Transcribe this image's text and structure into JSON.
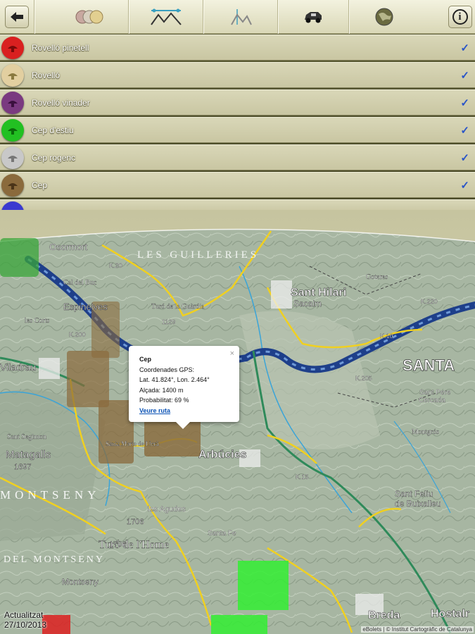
{
  "species": [
    {
      "label": "Rovelló pinetell",
      "color": "#d92020",
      "checked": "✓"
    },
    {
      "label": "Rovelló",
      "color": "#e2cfa0",
      "checked": "✓"
    },
    {
      "label": "Rovelló vinader",
      "color": "#7a3a80",
      "checked": "✓"
    },
    {
      "label": "Cep d'estiu",
      "color": "#22c022",
      "checked": "✓"
    },
    {
      "label": "Cep rogenc",
      "color": "#c8c8c8",
      "checked": "✓"
    },
    {
      "label": "Cep",
      "color": "#8a6a3c",
      "checked": "✓"
    }
  ],
  "toolbar": {
    "info_label": "i"
  },
  "map": {
    "places": {
      "osormort": "Osormort",
      "les_guilleries": "LES GUILLERIES",
      "sant_hilari": "Sant Hilari",
      "sacalm": "Sacalm",
      "santa": "SANTA",
      "espinelves": "Espinelves",
      "viladrau": "Viladrau",
      "matagalls": "Matagalls",
      "matagalls_alt": "1697",
      "arbucies": "Arbúcies",
      "sant_feliu": "Sant Feliu",
      "de_buixalleu": "de Buixalleu",
      "turo_home": "Turó de l'Home",
      "turo_alt": "1706",
      "turo_alt2": "1706",
      "del_montseny": "DEL MONTSENY",
      "montseny": "Montseny",
      "montseny_range": "MONTSENY",
      "breda": "Breda",
      "hostalric": "Hostalr",
      "les_agudes": "les Agudes",
      "santa_fe": "Santa Fe",
      "cal_buc": "Cal del Buc",
      "les_corts": "les Corts",
      "turo_guardia": "Turó de la Guàrdia",
      "sant_segimon": "Sant Segimon",
      "sant_pere": "Sant Pere",
      "cercada": "Cercada",
      "montgros": "Montgrós",
      "goteres": "Goteres",
      "santa_maria_llera": "Santa Maria de Llerà",
      "k10": "K.10",
      "k15": "K.15",
      "k20": "K.20",
      "k220": "K.220",
      "k200": "K.200",
      "k205": "K.205",
      "alt1129": "1129"
    }
  },
  "popup": {
    "title": "Cep",
    "gps_label": "Coordenades GPS:",
    "coords": "Lat. 41.824°, Lon. 2.464°",
    "altitude": "Alçada: 1400 m",
    "probability": "Probabilitat: 69 %",
    "route_link": "Veure ruta",
    "close": "×"
  },
  "footer": {
    "updated_label": "Actualitzat",
    "updated_date": "27/10/2013",
    "credits": "eBolets | © Institut Cartogràfic de Catalunya"
  }
}
